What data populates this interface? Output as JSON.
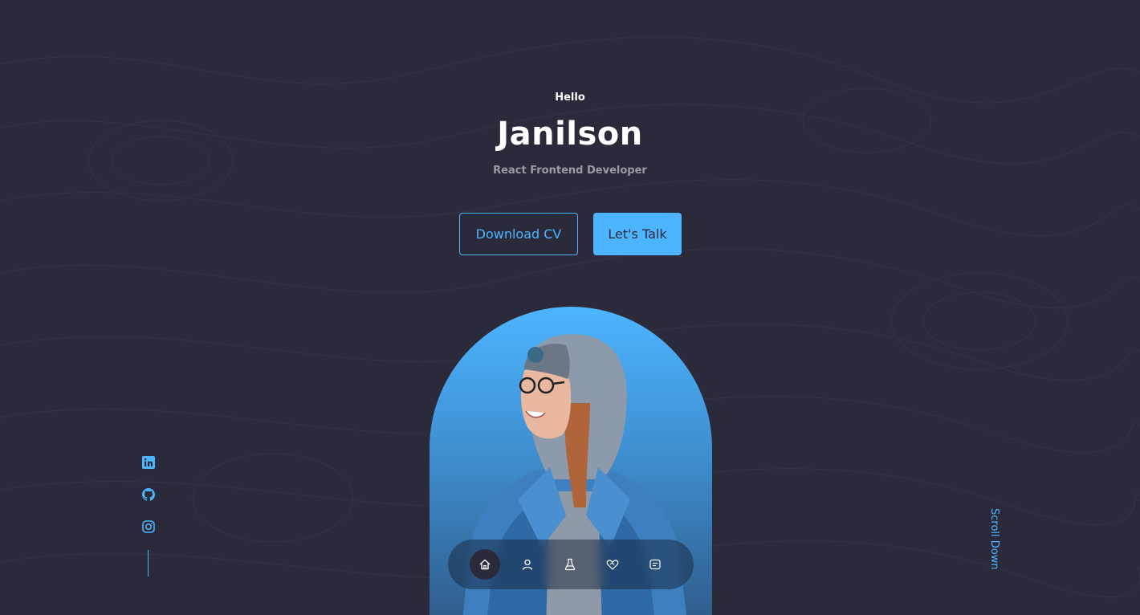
{
  "hero": {
    "greeting": "Hello",
    "name": "Janilson",
    "role": "React Frontend Developer"
  },
  "buttons": {
    "download_cv": "Download CV",
    "lets_talk": "Let's Talk"
  },
  "socials": [
    {
      "icon": "linkedin-icon"
    },
    {
      "icon": "github-icon"
    },
    {
      "icon": "instagram-icon"
    }
  ],
  "scroll": {
    "label": "Scroll Down"
  },
  "nav": {
    "items": [
      {
        "icon": "home-icon",
        "active": true
      },
      {
        "icon": "user-icon",
        "active": false
      },
      {
        "icon": "flask-icon",
        "active": false
      },
      {
        "icon": "heart-handshake-icon",
        "active": false
      },
      {
        "icon": "message-icon",
        "active": false
      }
    ]
  },
  "colors": {
    "background": "#2b2a3b",
    "accent": "#4db5ff",
    "muted_text": "#9b9ba8",
    "text": "#ffffff"
  }
}
